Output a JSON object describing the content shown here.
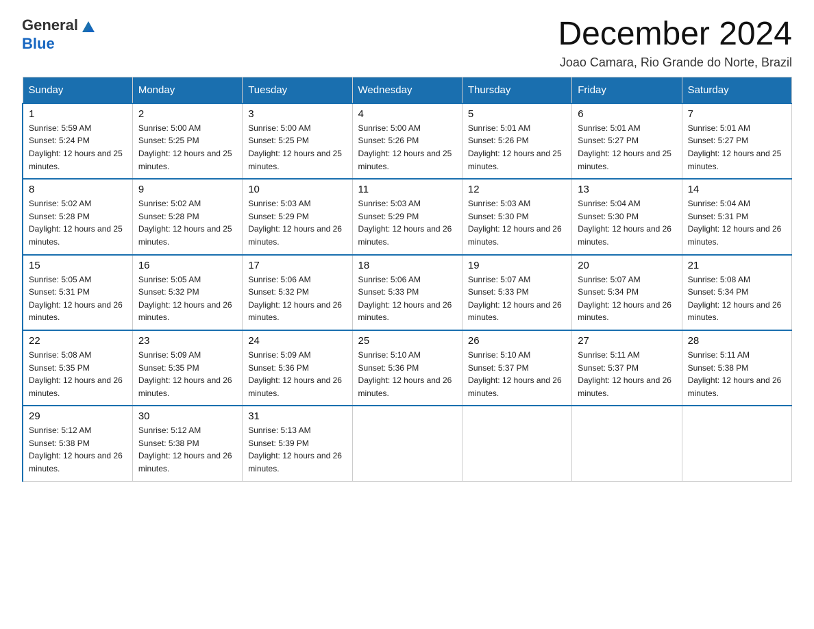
{
  "header": {
    "logo_general": "General",
    "logo_blue": "Blue",
    "month_title": "December 2024",
    "location": "Joao Camara, Rio Grande do Norte, Brazil"
  },
  "weekdays": [
    "Sunday",
    "Monday",
    "Tuesday",
    "Wednesday",
    "Thursday",
    "Friday",
    "Saturday"
  ],
  "weeks": [
    [
      {
        "day": "1",
        "sunrise": "5:59 AM",
        "sunset": "5:24 PM",
        "daylight": "12 hours and 25 minutes."
      },
      {
        "day": "2",
        "sunrise": "5:00 AM",
        "sunset": "5:25 PM",
        "daylight": "12 hours and 25 minutes."
      },
      {
        "day": "3",
        "sunrise": "5:00 AM",
        "sunset": "5:25 PM",
        "daylight": "12 hours and 25 minutes."
      },
      {
        "day": "4",
        "sunrise": "5:00 AM",
        "sunset": "5:26 PM",
        "daylight": "12 hours and 25 minutes."
      },
      {
        "day": "5",
        "sunrise": "5:01 AM",
        "sunset": "5:26 PM",
        "daylight": "12 hours and 25 minutes."
      },
      {
        "day": "6",
        "sunrise": "5:01 AM",
        "sunset": "5:27 PM",
        "daylight": "12 hours and 25 minutes."
      },
      {
        "day": "7",
        "sunrise": "5:01 AM",
        "sunset": "5:27 PM",
        "daylight": "12 hours and 25 minutes."
      }
    ],
    [
      {
        "day": "8",
        "sunrise": "5:02 AM",
        "sunset": "5:28 PM",
        "daylight": "12 hours and 25 minutes."
      },
      {
        "day": "9",
        "sunrise": "5:02 AM",
        "sunset": "5:28 PM",
        "daylight": "12 hours and 25 minutes."
      },
      {
        "day": "10",
        "sunrise": "5:03 AM",
        "sunset": "5:29 PM",
        "daylight": "12 hours and 26 minutes."
      },
      {
        "day": "11",
        "sunrise": "5:03 AM",
        "sunset": "5:29 PM",
        "daylight": "12 hours and 26 minutes."
      },
      {
        "day": "12",
        "sunrise": "5:03 AM",
        "sunset": "5:30 PM",
        "daylight": "12 hours and 26 minutes."
      },
      {
        "day": "13",
        "sunrise": "5:04 AM",
        "sunset": "5:30 PM",
        "daylight": "12 hours and 26 minutes."
      },
      {
        "day": "14",
        "sunrise": "5:04 AM",
        "sunset": "5:31 PM",
        "daylight": "12 hours and 26 minutes."
      }
    ],
    [
      {
        "day": "15",
        "sunrise": "5:05 AM",
        "sunset": "5:31 PM",
        "daylight": "12 hours and 26 minutes."
      },
      {
        "day": "16",
        "sunrise": "5:05 AM",
        "sunset": "5:32 PM",
        "daylight": "12 hours and 26 minutes."
      },
      {
        "day": "17",
        "sunrise": "5:06 AM",
        "sunset": "5:32 PM",
        "daylight": "12 hours and 26 minutes."
      },
      {
        "day": "18",
        "sunrise": "5:06 AM",
        "sunset": "5:33 PM",
        "daylight": "12 hours and 26 minutes."
      },
      {
        "day": "19",
        "sunrise": "5:07 AM",
        "sunset": "5:33 PM",
        "daylight": "12 hours and 26 minutes."
      },
      {
        "day": "20",
        "sunrise": "5:07 AM",
        "sunset": "5:34 PM",
        "daylight": "12 hours and 26 minutes."
      },
      {
        "day": "21",
        "sunrise": "5:08 AM",
        "sunset": "5:34 PM",
        "daylight": "12 hours and 26 minutes."
      }
    ],
    [
      {
        "day": "22",
        "sunrise": "5:08 AM",
        "sunset": "5:35 PM",
        "daylight": "12 hours and 26 minutes."
      },
      {
        "day": "23",
        "sunrise": "5:09 AM",
        "sunset": "5:35 PM",
        "daylight": "12 hours and 26 minutes."
      },
      {
        "day": "24",
        "sunrise": "5:09 AM",
        "sunset": "5:36 PM",
        "daylight": "12 hours and 26 minutes."
      },
      {
        "day": "25",
        "sunrise": "5:10 AM",
        "sunset": "5:36 PM",
        "daylight": "12 hours and 26 minutes."
      },
      {
        "day": "26",
        "sunrise": "5:10 AM",
        "sunset": "5:37 PM",
        "daylight": "12 hours and 26 minutes."
      },
      {
        "day": "27",
        "sunrise": "5:11 AM",
        "sunset": "5:37 PM",
        "daylight": "12 hours and 26 minutes."
      },
      {
        "day": "28",
        "sunrise": "5:11 AM",
        "sunset": "5:38 PM",
        "daylight": "12 hours and 26 minutes."
      }
    ],
    [
      {
        "day": "29",
        "sunrise": "5:12 AM",
        "sunset": "5:38 PM",
        "daylight": "12 hours and 26 minutes."
      },
      {
        "day": "30",
        "sunrise": "5:12 AM",
        "sunset": "5:38 PM",
        "daylight": "12 hours and 26 minutes."
      },
      {
        "day": "31",
        "sunrise": "5:13 AM",
        "sunset": "5:39 PM",
        "daylight": "12 hours and 26 minutes."
      },
      null,
      null,
      null,
      null
    ]
  ]
}
